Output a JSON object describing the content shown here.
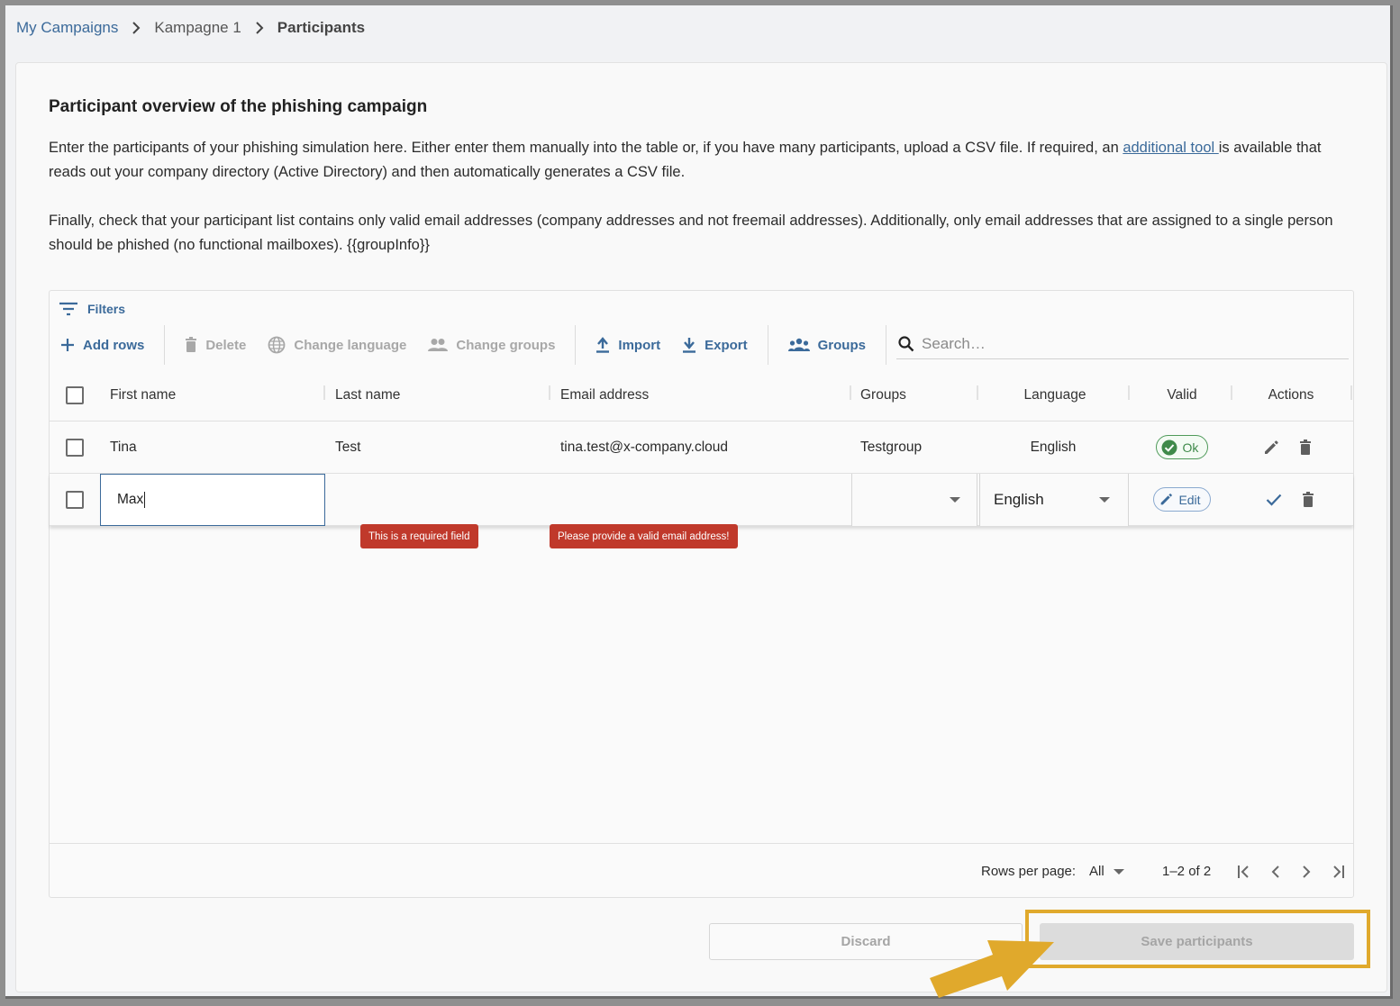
{
  "breadcrumb": {
    "items": [
      "My Campaigns",
      "Kampagne 1",
      "Participants"
    ]
  },
  "card": {
    "title": "Participant overview of the phishing campaign",
    "para1_before_link": "Enter the participants of your phishing simulation here. Either enter them manually into the table or, if you have many participants, upload a CSV file. If required, an ",
    "para1_link": "additional tool ",
    "para1_after_link": "is available that reads out your company directory (Active Directory) and then automatically generates a CSV file.",
    "para2": "Finally, check that your participant list contains only valid email addresses (company addresses and not freemail addresses). Additionally, only email addresses that are assigned to a single person should be phished (no functional mailboxes). {{groupInfo}}"
  },
  "toolbar": {
    "filters": "Filters",
    "add_rows": "Add rows",
    "delete": "Delete",
    "change_language": "Change language",
    "change_groups": "Change groups",
    "import": "Import",
    "export": "Export",
    "groups": "Groups",
    "search_placeholder": "Search…"
  },
  "table": {
    "columns": [
      "First name",
      "Last name",
      "Email address",
      "Groups",
      "Language",
      "Valid",
      "Actions"
    ],
    "rows": [
      {
        "first_name": "Tina",
        "last_name": "Test",
        "email": "tina.test@x-company.cloud",
        "groups": "Testgroup",
        "language": "English",
        "valid": "Ok"
      }
    ],
    "edit_row": {
      "first_name": "Max",
      "language": "English",
      "valid": "Edit"
    },
    "errors": {
      "last_name": "This is a required field",
      "email": "Please provide a valid email address!"
    }
  },
  "pagination": {
    "rows_per_page_label": "Rows per page:",
    "rows_per_page_value": "All",
    "range": "1–2 of 2"
  },
  "buttons": {
    "discard": "Discard",
    "save": "Save participants"
  },
  "colors": {
    "accent": "#3b6a9a",
    "error": "#c0392b",
    "ok": "#3f8a4a",
    "highlight": "#e0a92c"
  }
}
